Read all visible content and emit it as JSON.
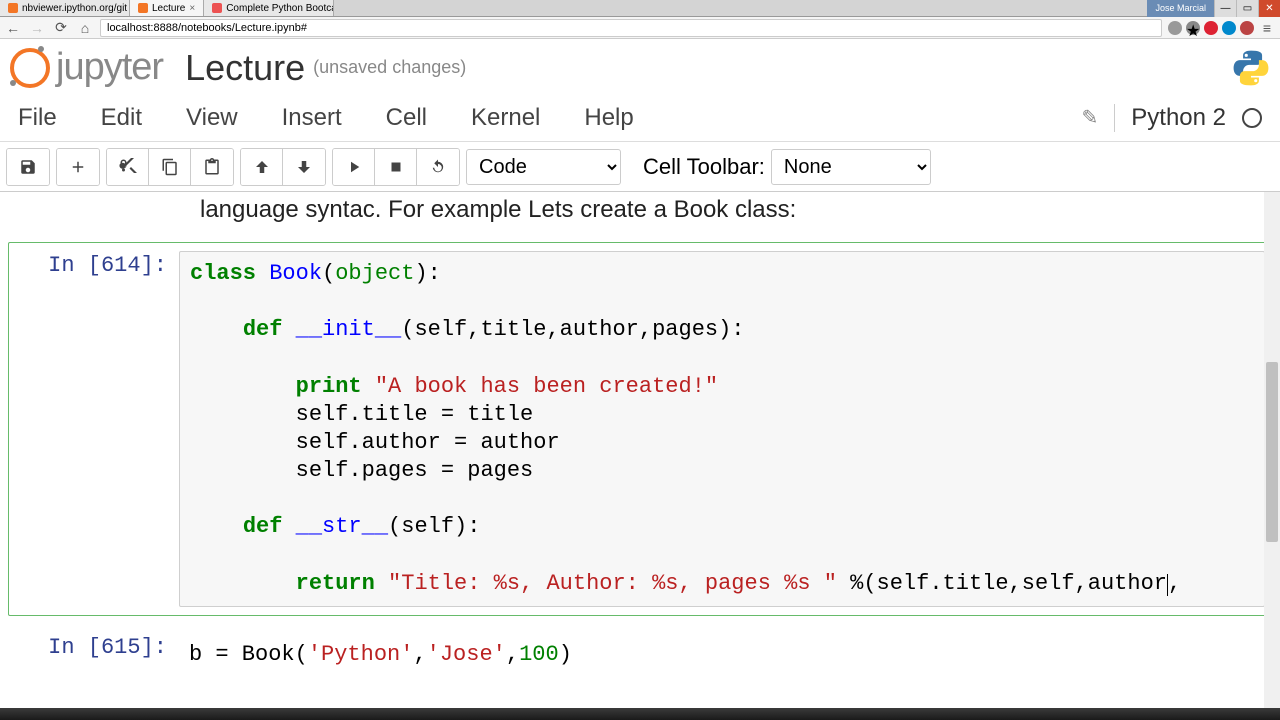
{
  "browser": {
    "tabs": [
      {
        "title": "nbviewer.ipython.org/git",
        "active": false
      },
      {
        "title": "Lecture",
        "active": true
      },
      {
        "title": "Complete Python Bootca",
        "active": false
      }
    ],
    "user": "Jose Marcial",
    "url": "localhost:8888/notebooks/Lecture.ipynb#"
  },
  "jupyter": {
    "logo_text": "jupyter",
    "notebook_name": "Lecture",
    "save_status": "(unsaved changes)"
  },
  "menu": {
    "items": [
      "File",
      "Edit",
      "View",
      "Insert",
      "Cell",
      "Kernel",
      "Help"
    ],
    "kernel": "Python 2"
  },
  "toolbar": {
    "cell_type": "Code",
    "cell_toolbar_label": "Cell Toolbar:",
    "cell_toolbar_value": "None"
  },
  "content": {
    "markdown_fragment": "language syntac. For example Lets create a Book class:",
    "cells": [
      {
        "prompt": "In [614]:",
        "tokens": [
          {
            "t": "class ",
            "c": "kw-green"
          },
          {
            "t": "Book",
            "c": "cls-blue"
          },
          {
            "t": "(",
            "c": ""
          },
          {
            "t": "object",
            "c": "builtin"
          },
          {
            "t": "):",
            "c": ""
          },
          {
            "br": 1
          },
          {
            "br": 1
          },
          {
            "t": "    ",
            "c": ""
          },
          {
            "t": "def ",
            "c": "kw-green"
          },
          {
            "t": "__init__",
            "c": "dunder"
          },
          {
            "t": "(self,title,author,pages):",
            "c": ""
          },
          {
            "br": 1
          },
          {
            "br": 1
          },
          {
            "t": "        ",
            "c": ""
          },
          {
            "t": "print ",
            "c": "kw-green"
          },
          {
            "t": "\"A book has been created!\"",
            "c": "string"
          },
          {
            "br": 1
          },
          {
            "t": "        self.title = title",
            "c": ""
          },
          {
            "br": 1
          },
          {
            "t": "        self.author = author",
            "c": ""
          },
          {
            "br": 1
          },
          {
            "t": "        self.pages = pages",
            "c": ""
          },
          {
            "br": 1
          },
          {
            "br": 1
          },
          {
            "t": "    ",
            "c": ""
          },
          {
            "t": "def ",
            "c": "kw-green"
          },
          {
            "t": "__str__",
            "c": "dunder"
          },
          {
            "t": "(self):",
            "c": ""
          },
          {
            "br": 1
          },
          {
            "br": 1
          },
          {
            "t": "        ",
            "c": ""
          },
          {
            "t": "return ",
            "c": "kw-green"
          },
          {
            "t": "\"Title: %s, Author: %s, pages %s \"",
            "c": "string"
          },
          {
            "t": " %(self.title,self,author",
            "c": ""
          },
          {
            "cursor": 1
          },
          {
            "t": ",",
            "c": ""
          }
        ]
      },
      {
        "prompt": "In [615]:",
        "tokens": [
          {
            "t": "b = Book(",
            "c": ""
          },
          {
            "t": "'Python'",
            "c": "string"
          },
          {
            "t": ",",
            "c": ""
          },
          {
            "t": "'Jose'",
            "c": "string"
          },
          {
            "t": ",",
            "c": ""
          },
          {
            "t": "100",
            "c": "builtin"
          },
          {
            "t": ")",
            "c": ""
          }
        ]
      }
    ]
  }
}
